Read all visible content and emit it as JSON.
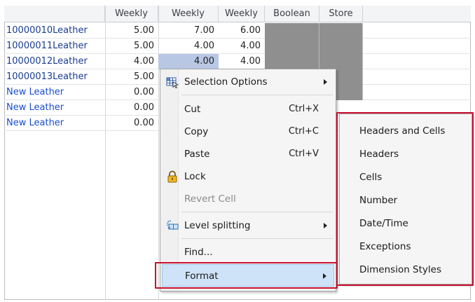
{
  "grid": {
    "headers": [
      "Weekly",
      "Weekly",
      "Weekly",
      "Boolean",
      "Store"
    ],
    "rows": [
      {
        "name": "10000010Leather",
        "c1": "5.00",
        "c2": "7.00",
        "c3": "6.00"
      },
      {
        "name": "10000011Leather",
        "c1": "5.00",
        "c2": "4.00",
        "c3": "4.00"
      },
      {
        "name": "10000012Leather",
        "c1": "4.00",
        "c2": "4.00",
        "c3": "4.00"
      },
      {
        "name": "10000013Leather",
        "c1": "5.00",
        "c2": "",
        "c3": ""
      },
      {
        "name": "New Leather",
        "c1": "0.00",
        "c2": "",
        "c3": ""
      },
      {
        "name": "New Leather",
        "c1": "0.00",
        "c2": "",
        "c3": ""
      },
      {
        "name": "New Leather",
        "c1": "0.00",
        "c2": "",
        "c3": ""
      }
    ]
  },
  "menu": {
    "selection_options": "Selection Options",
    "cut": "Cut",
    "cut_shortcut": "Ctrl+X",
    "copy": "Copy",
    "copy_shortcut": "Ctrl+C",
    "paste": "Paste",
    "paste_shortcut": "Ctrl+V",
    "lock": "Lock",
    "revert_cell": "Revert Cell",
    "level_splitting": "Level splitting",
    "find": "Find...",
    "format": "Format"
  },
  "submenu": {
    "items": [
      "Headers and Cells",
      "Headers",
      "Cells",
      "Number",
      "Date/Time",
      "Exceptions",
      "Dimension Styles"
    ]
  },
  "icons": {
    "selection_options": "selection-grid-icon",
    "lock": "padlock-icon",
    "level_splitting": "split-icon"
  },
  "colors": {
    "callout": "#c8102e",
    "highlight": "#cfe3f8",
    "link_text": "#1a3d8f",
    "gray_cell": "#8f8f8f"
  }
}
